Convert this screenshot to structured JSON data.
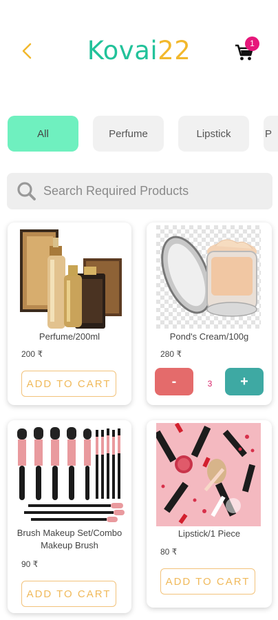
{
  "header": {
    "logo_part1": "Kovai",
    "logo_part2": "22",
    "cart_count": "1",
    "colors": {
      "brand_green": "#22c29a",
      "brand_yellow": "#f2b82c",
      "back_arrow": "#f2b82c",
      "badge": "#e6177a"
    }
  },
  "categories": [
    {
      "label": "All",
      "active": true
    },
    {
      "label": "Perfume",
      "active": false
    },
    {
      "label": "Lipstick",
      "active": false
    },
    {
      "label": "P",
      "active": false
    }
  ],
  "search": {
    "placeholder": "Search Required Products"
  },
  "products": [
    {
      "name": "Perfume/200ml",
      "price": "200 ₹",
      "action": "ADD TO CART"
    },
    {
      "name": "Pond's Cream/100g",
      "price": "280 ₹",
      "quantity": "3",
      "minus_label": "-",
      "plus_label": "+"
    },
    {
      "name": "Brush Makeup Set/Combo Makeup Brush",
      "price": "90 ₹",
      "action": "ADD TO CART"
    },
    {
      "name": "Lipstick/1 Piece",
      "price": "80 ₹",
      "action": "ADD TO CART"
    }
  ]
}
